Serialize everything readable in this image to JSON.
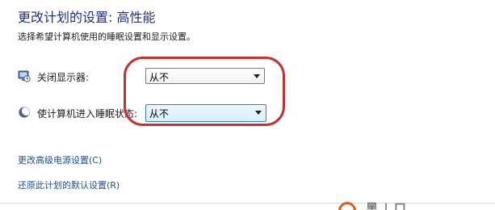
{
  "page": {
    "title": "更改计划的设置: 高性能",
    "subtitle": "选择希望计算机使用的睡眠设置和显示设置。"
  },
  "settings": {
    "display_off": {
      "label": "关闭显示器:",
      "icon": "monitor-clock-icon",
      "value": "从不"
    },
    "sleep": {
      "label": "使计算机进入睡眠状态:",
      "icon": "moon-icon",
      "value": "从不"
    }
  },
  "links": {
    "advanced": "更改高级电源设置(C)",
    "restore_defaults": "还原此计划的默认设置(R)"
  },
  "annotation": {
    "color": "#c8302e"
  },
  "watermark": {
    "text": "黑 | 口",
    "color": "#e35a1c"
  }
}
